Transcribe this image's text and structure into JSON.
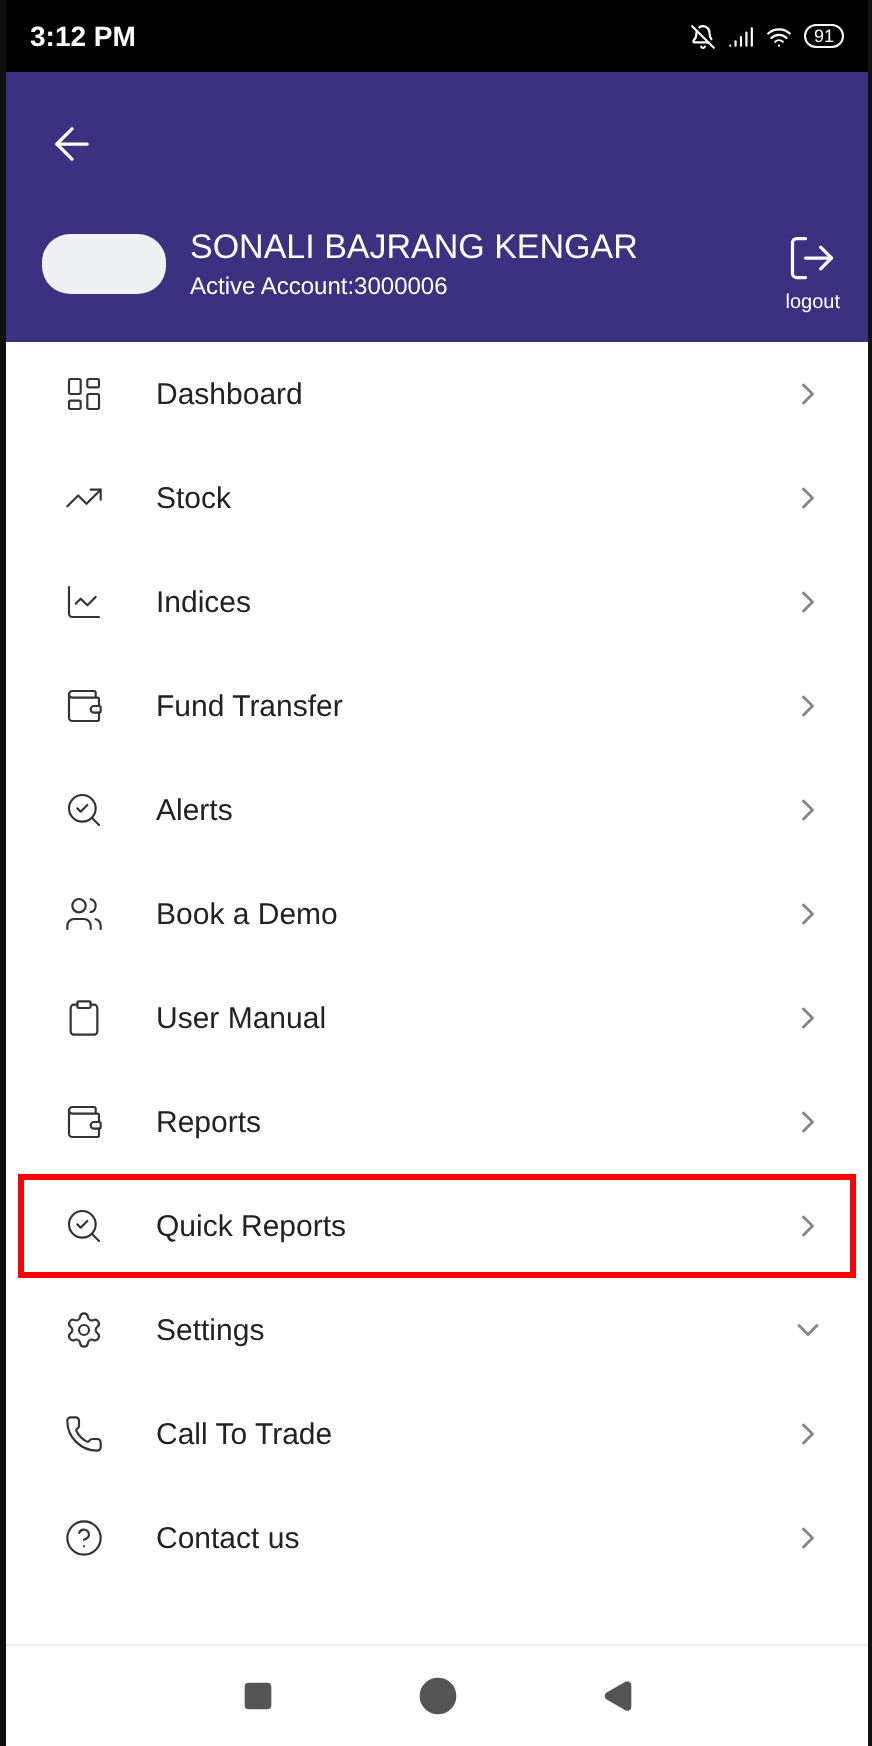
{
  "status_bar": {
    "time": "3:12 PM",
    "battery": "91"
  },
  "header": {
    "user_name": "SONALI BAJRANG KENGAR",
    "account": "Active Account:3000006",
    "logout_label": "logout"
  },
  "menu": [
    {
      "label": "Dashboard",
      "kind": "link",
      "highlighted": false
    },
    {
      "label": "Stock",
      "kind": "link",
      "highlighted": false
    },
    {
      "label": "Indices",
      "kind": "link",
      "highlighted": false
    },
    {
      "label": "Fund Transfer",
      "kind": "link",
      "highlighted": false
    },
    {
      "label": "Alerts",
      "kind": "link",
      "highlighted": false
    },
    {
      "label": "Book a Demo",
      "kind": "link",
      "highlighted": false
    },
    {
      "label": "User Manual",
      "kind": "link",
      "highlighted": false
    },
    {
      "label": "Reports",
      "kind": "link",
      "highlighted": false
    },
    {
      "label": "Quick Reports",
      "kind": "link",
      "highlighted": true
    },
    {
      "label": "Settings",
      "kind": "expandable",
      "highlighted": false
    },
    {
      "label": "Call To Trade",
      "kind": "link",
      "highlighted": false
    },
    {
      "label": "Contact us",
      "kind": "link",
      "highlighted": false
    }
  ]
}
